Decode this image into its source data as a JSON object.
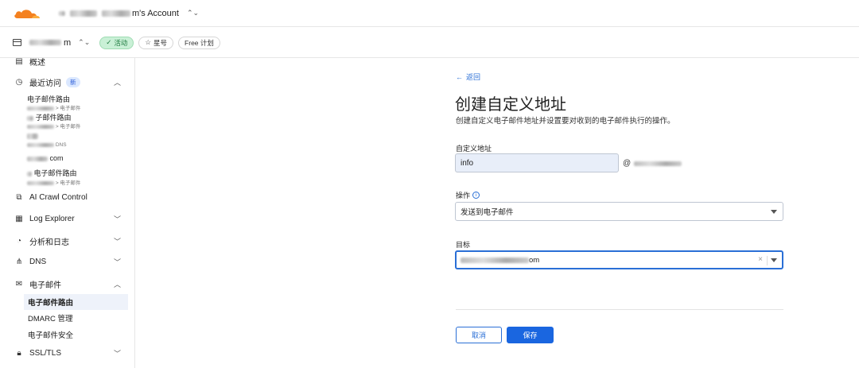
{
  "header": {
    "account_suffix": "m's Account",
    "account_toggle": "⌃⌄"
  },
  "zone": {
    "name_suffix": "m",
    "status": "活动",
    "star_label": "星号",
    "plan": "Free 计划"
  },
  "sidebar": {
    "overview": "概述",
    "recent": {
      "label": "最近访问",
      "badge": "新"
    },
    "recent_items": [
      {
        "title": "电子邮件路由",
        "sub": "> 电子邮件"
      },
      {
        "title": "子邮件路由",
        "sub": "> 电子邮件"
      },
      {
        "title": "",
        "sub": "DNS"
      },
      {
        "title": "com",
        "sub": ""
      },
      {
        "title": "电子邮件路由",
        "sub": "> 电子邮件"
      }
    ],
    "items": [
      {
        "label": "AI Crawl Control"
      },
      {
        "label": "Log Explorer"
      },
      {
        "label": "分析和日志"
      },
      {
        "label": "DNS"
      },
      {
        "label": "电子邮件"
      }
    ],
    "email_sub": [
      "电子邮件路由",
      "DMARC 管理",
      "电子邮件安全"
    ],
    "ssl": "SSL/TLS"
  },
  "main": {
    "back": "返回",
    "title": "创建自定义地址",
    "description": "创建自定义电子邮件地址并设置要对收到的电子邮件执行的操作。",
    "custom_label": "自定义地址",
    "custom_value": "info",
    "at": "@",
    "action_label": "操作",
    "action_value": "发送到电子邮件",
    "target_label": "目标",
    "target_suffix": "om",
    "clear": "×",
    "cancel": "取消",
    "save": "保存"
  },
  "colors": {
    "accent": "#1a66e0",
    "link": "#2a6fd6",
    "logo_orange": "#f48120",
    "status_green_bg": "#c9f0d6"
  }
}
